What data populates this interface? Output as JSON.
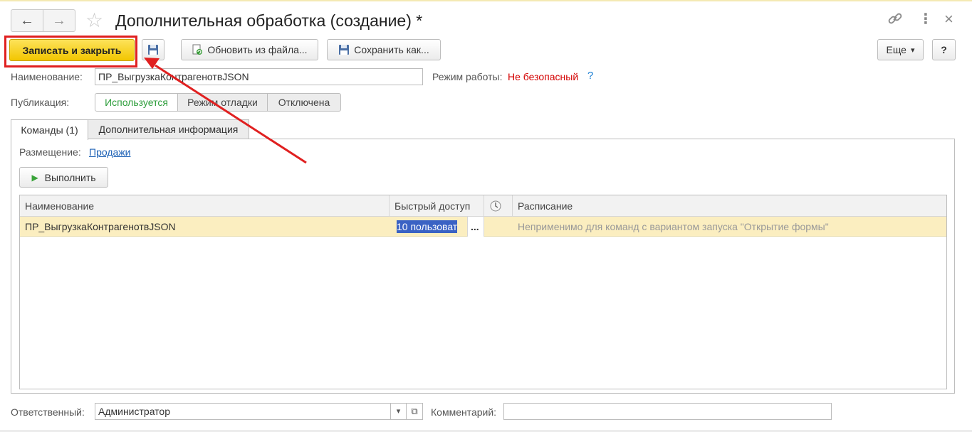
{
  "window": {
    "title": "Дополнительная обработка (создание) *",
    "back_icon": "←",
    "forward_icon": "→",
    "star_icon": "☆",
    "link_icon": "🔗",
    "more_icon": "⋮",
    "close_icon": "×"
  },
  "toolbar": {
    "save_close_label": "Записать и закрыть",
    "update_from_file_label": "Обновить из файла...",
    "save_as_label": "Сохранить как...",
    "more_label": "Еще",
    "more_arrow": "▾",
    "help_label": "?"
  },
  "form": {
    "name_label": "Наименование:",
    "name_value": "ПР_ВыгрузкаКонтрагенотвJSON",
    "mode_label": "Режим работы:",
    "mode_value": "Не безопасный",
    "mode_help": "?",
    "publication_label": "Публикация:",
    "publication_options": [
      "Используется",
      "Режим отладки",
      "Отключена"
    ],
    "publication_selected": "Используется"
  },
  "tabs": [
    "Команды (1)",
    "Дополнительная информация"
  ],
  "commands": {
    "placement_label": "Размещение:",
    "placement_value": "Продажи",
    "run_label": "Выполнить",
    "run_icon": "▶",
    "columns": [
      "Наименование",
      "Быстрый доступ",
      "",
      "Расписание"
    ],
    "rows": [
      {
        "name": "ПР_ВыгрузкаКонтрагенотвJSON",
        "quick_access": "10 пользоват",
        "select": "...",
        "schedule": "Неприменимо для команд с вариантом запуска \"Открытие формы\""
      }
    ]
  },
  "footer": {
    "responsible_label": "Ответственный:",
    "responsible_value": "Администратор",
    "dropdown_icon": "▾",
    "open_icon": "⧉",
    "comment_label": "Комментарий:",
    "comment_value": ""
  },
  "colors": {
    "accent_yellow": "#f7d117",
    "annotation_red": "#e02020",
    "link_blue": "#1a5fb4",
    "unsafe_red": "#d40000",
    "active_green": "#2e9e3c",
    "row_highlight": "#fbeec0",
    "selection_blue": "#3a62c4"
  }
}
